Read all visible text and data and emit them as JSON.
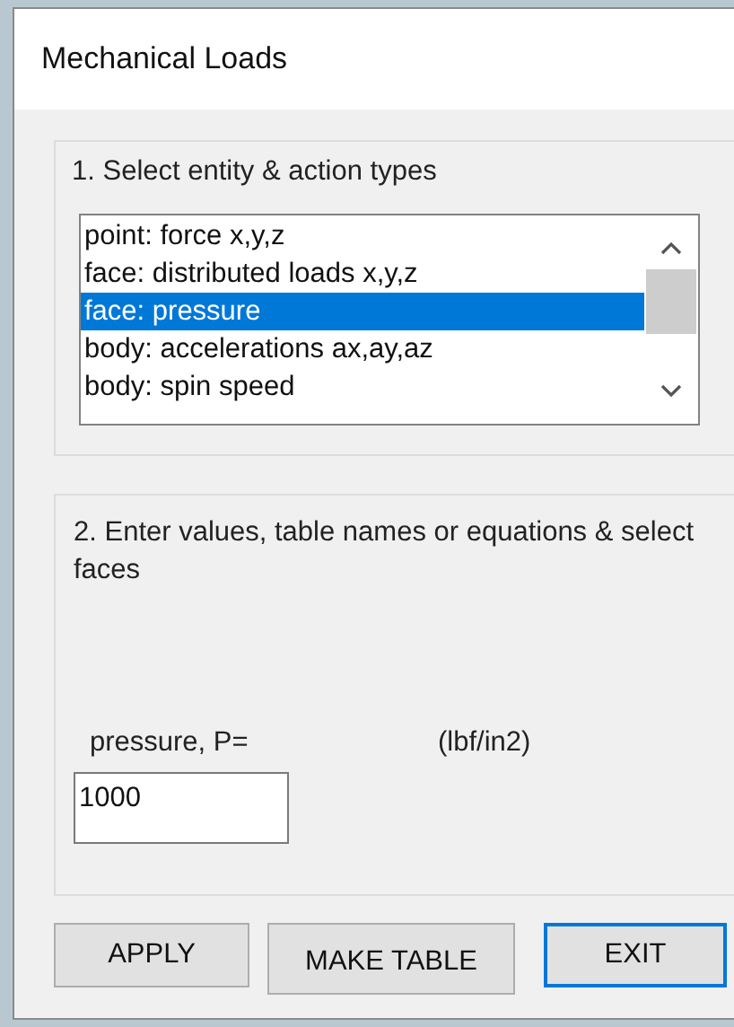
{
  "window": {
    "title": "Mechanical Loads"
  },
  "step1": {
    "heading": "1. Select entity & action types",
    "items": [
      {
        "label": "point: force x,y,z",
        "selected": false
      },
      {
        "label": "face: distributed loads x,y,z",
        "selected": false
      },
      {
        "label": "face: pressure",
        "selected": true
      },
      {
        "label": "body: accelerations ax,ay,az",
        "selected": false
      },
      {
        "label": "body: spin speed",
        "selected": false
      }
    ]
  },
  "step2": {
    "heading": "2. Enter values, table names or equations & select faces",
    "field_label": "pressure, P=",
    "units": "(lbf/in2)",
    "value": "1000"
  },
  "buttons": [
    {
      "label": "APPLY",
      "focused": false
    },
    {
      "label": "MAKE TABLE",
      "focused": false
    },
    {
      "label": "EXIT",
      "focused": true
    }
  ]
}
